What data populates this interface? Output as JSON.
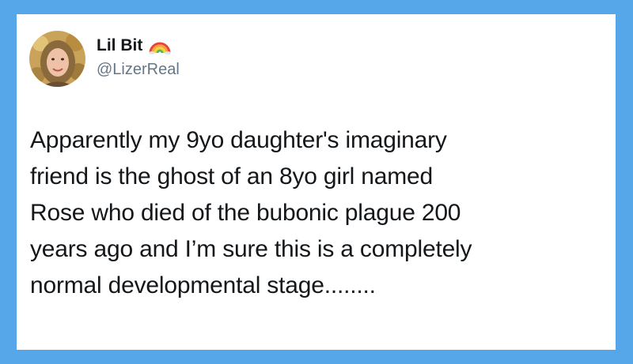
{
  "colors": {
    "background": "#55a7ea",
    "card": "#ffffff",
    "name": "#14171a",
    "handle": "#657786",
    "text": "#14171a"
  },
  "user": {
    "display_name": "Lil Bit",
    "badge_icon": "rainbow-emoji",
    "handle": "@LizerReal"
  },
  "tweet": {
    "lines": [
      "Apparently my 9yo daughter's imaginary",
      "friend is the ghost of an 8yo girl named",
      "Rose who died of the bubonic plague 200",
      "years ago and I’m sure this is a completely",
      "normal developmental stage........"
    ]
  }
}
